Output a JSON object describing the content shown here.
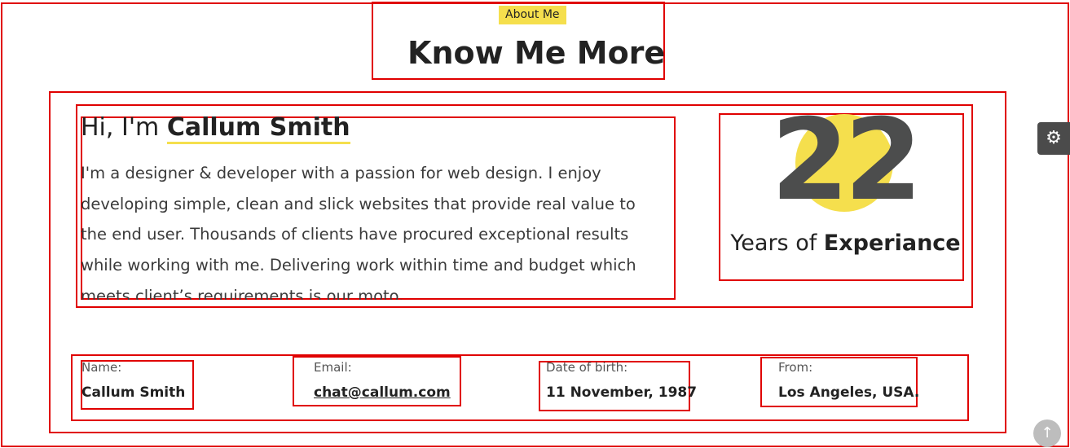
{
  "header": {
    "tag": "About Me",
    "title": "Know Me More"
  },
  "about": {
    "greeting_prefix": "Hi, I'm ",
    "name": "Callum Smith",
    "bio_lines": [
      "I'm a designer & developer with a passion for web design. I enjoy",
      "developing simple, clean and slick websites that provide real value to",
      "the end user. Thousands of clients have procured exceptional results",
      "while working with me. Delivering work within time and budget which",
      "meets client’s requirements is our moto."
    ]
  },
  "experience": {
    "years": "22",
    "label_prefix": "Years of ",
    "label_bold": "Experiance"
  },
  "info": {
    "name_label": "Name:",
    "name_value": "Callum Smith",
    "email_label": "Email:",
    "email_value": "chat@callum.com",
    "dob_label": "Date of birth:",
    "dob_value": "11 November, 1987",
    "from_label": "From:",
    "from_value": "Los Angeles, USA."
  },
  "controls": {
    "settings_icon": "gear-icon",
    "scroll_icon": "arrow-up-icon"
  },
  "colors": {
    "accent": "#f5df4d",
    "dark": "#4c4d4d",
    "annotation_box": "#e00000"
  }
}
